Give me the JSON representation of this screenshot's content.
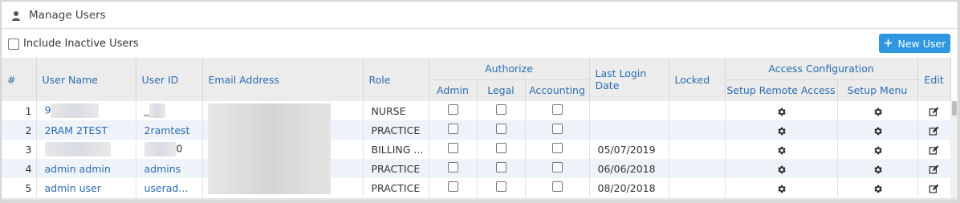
{
  "panel": {
    "title": "Manage Users",
    "user_icon": "user-icon"
  },
  "toolbar": {
    "include_inactive_label": "Include Inactive Users",
    "new_user_label": "New User"
  },
  "table": {
    "headers": {
      "num": "#",
      "user_name": "User Name",
      "user_id": "User ID",
      "email": "Email Address",
      "role": "Role",
      "authorize": "Authorize",
      "admin": "Admin",
      "legal": "Legal",
      "accounting": "Accounting",
      "last_login": "Last Login Date",
      "locked": "Locked",
      "access_config": "Access Configuration",
      "setup_remote": "Setup Remote Access",
      "setup_menu": "Setup Menu",
      "edit": "Edit"
    },
    "rows": [
      {
        "num": "1",
        "user_name": "9",
        "user_id": "_",
        "role": "NURSE",
        "last_login": ""
      },
      {
        "num": "2",
        "user_name": "2RAM 2TEST",
        "user_id": "2ramtest",
        "role": "PRACTICE",
        "last_login": ""
      },
      {
        "num": "3",
        "user_name": "",
        "user_id": "0",
        "role": "BILLING ...",
        "last_login": "05/07/2019"
      },
      {
        "num": "4",
        "user_name": "admin admin",
        "user_id": "admins",
        "role": "PRACTICE",
        "last_login": "06/06/2018"
      },
      {
        "num": "5",
        "user_name": "admin user",
        "user_id": "userad...",
        "role": "PRACTICE",
        "last_login": "08/20/2018"
      }
    ]
  },
  "colors": {
    "accent": "#2f97e0",
    "link": "#2a6bb0",
    "header_bg": "#ececec",
    "alt_row": "#eef3fa"
  }
}
